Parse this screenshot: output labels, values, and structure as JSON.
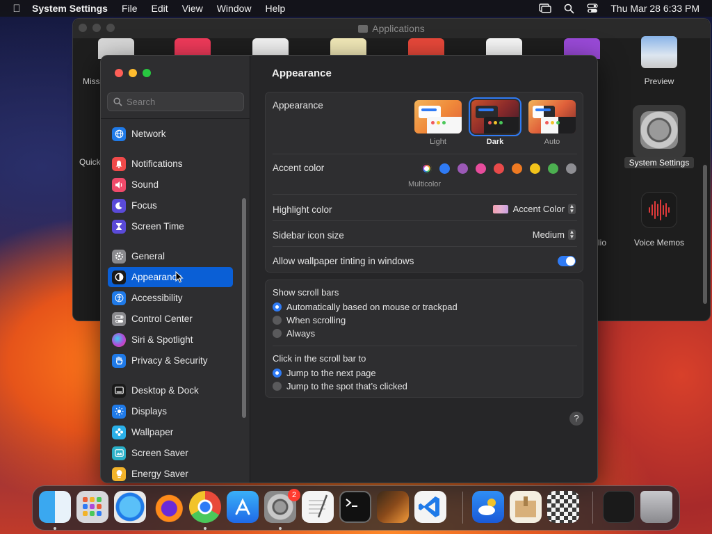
{
  "menubar": {
    "app_name": "System Settings",
    "menus": [
      "File",
      "Edit",
      "View",
      "Window",
      "Help"
    ],
    "clock": "Thu Mar 28  6:33 PM"
  },
  "finder": {
    "title": "Applications",
    "labels": {
      "miss": "Miss",
      "quick": "Quick",
      "preview": "Preview",
      "system_settings": "System Settings",
      "voice_memos": "Voice Memos",
      "lio": "lio"
    }
  },
  "sidebar": {
    "search_placeholder": "Search",
    "items": [
      {
        "label": "Network",
        "icon": "globe-icon",
        "color": "#1f7ae8"
      },
      {
        "label": "Notifications",
        "icon": "bell-icon",
        "color": "#f04a4a"
      },
      {
        "label": "Sound",
        "icon": "speaker-icon",
        "color": "#f04a6a"
      },
      {
        "label": "Focus",
        "icon": "moon-icon",
        "color": "#5a4ad8"
      },
      {
        "label": "Screen Time",
        "icon": "hourglass-icon",
        "color": "#5a4ad8"
      },
      {
        "label": "General",
        "icon": "gear-icon",
        "color": "#8a8a8e"
      },
      {
        "label": "Appearance",
        "icon": "appearance-icon",
        "color": "#1a1a1a"
      },
      {
        "label": "Accessibility",
        "icon": "accessibility-icon",
        "color": "#1f7ae8"
      },
      {
        "label": "Control Center",
        "icon": "control-center-icon",
        "color": "#8a8a8e"
      },
      {
        "label": "Siri & Spotlight",
        "icon": "siri-icon",
        "color": "#b04ad8"
      },
      {
        "label": "Privacy & Security",
        "icon": "hand-icon",
        "color": "#1f7ae8"
      },
      {
        "label": "Desktop & Dock",
        "icon": "dock-icon",
        "color": "#1a1a1a"
      },
      {
        "label": "Displays",
        "icon": "sun-icon",
        "color": "#1f7ae8"
      },
      {
        "label": "Wallpaper",
        "icon": "flower-icon",
        "color": "#2ab0e8"
      },
      {
        "label": "Screen Saver",
        "icon": "screen-saver-icon",
        "color": "#2ab0c8"
      },
      {
        "label": "Energy Saver",
        "icon": "bulb-icon",
        "color": "#f2b32a"
      }
    ]
  },
  "content": {
    "title": "Appearance",
    "appearance": {
      "label": "Appearance",
      "options": [
        "Light",
        "Dark",
        "Auto"
      ],
      "selected": "Dark"
    },
    "accent": {
      "label": "Accent color",
      "caption": "Multicolor",
      "colors": [
        "#2f7bf5",
        "#9b59b6",
        "#e74c9c",
        "#e84a4a",
        "#ee7a22",
        "#f2c31a",
        "#4caf50",
        "#8e8e93"
      ]
    },
    "highlight": {
      "label": "Highlight color",
      "value": "Accent Color"
    },
    "icon_size": {
      "label": "Sidebar icon size",
      "value": "Medium"
    },
    "tinting": {
      "label": "Allow wallpaper tinting in windows",
      "on": true
    },
    "scroll_bars": {
      "label": "Show scroll bars",
      "options": [
        "Automatically based on mouse or trackpad",
        "When scrolling",
        "Always"
      ],
      "selected": 0
    },
    "click_scroll": {
      "label": "Click in the scroll bar to",
      "options": [
        "Jump to the next page",
        "Jump to the spot that’s clicked"
      ],
      "selected": 0
    },
    "help": "?"
  },
  "dock": {
    "badge": "2",
    "apps": [
      "finder-icon",
      "launchpad-icon",
      "safari-icon",
      "firefox-icon",
      "chrome-icon",
      "app-store-icon",
      "system-settings-icon",
      "textedit-icon",
      "terminal-icon",
      "garageband-icon",
      "vscode-icon",
      "weather-icon",
      "archive-icon",
      "chess-icon",
      "window-stack-icon",
      "trash-icon"
    ]
  }
}
